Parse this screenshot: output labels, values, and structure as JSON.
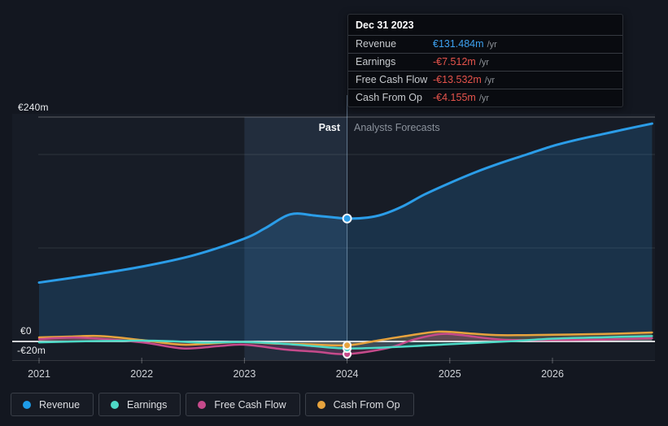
{
  "tooltip": {
    "title": "Dec 31 2023",
    "rows": [
      {
        "label": "Revenue",
        "value": "€131.484m",
        "unit": "/yr",
        "color": "#3da1f0"
      },
      {
        "label": "Earnings",
        "value": "-€7.512m",
        "unit": "/yr",
        "color": "#e5534b"
      },
      {
        "label": "Free Cash Flow",
        "value": "-€13.532m",
        "unit": "/yr",
        "color": "#e5534b"
      },
      {
        "label": "Cash From Op",
        "value": "-€4.155m",
        "unit": "/yr",
        "color": "#e5534b"
      }
    ]
  },
  "labels": {
    "past": "Past",
    "forecast": "Analysts Forecasts"
  },
  "y_axis": {
    "top": "€240m",
    "zero": "€0",
    "bottom": "-€20m"
  },
  "legend": {
    "items": [
      {
        "label": "Revenue",
        "color": "#1e9ce8"
      },
      {
        "label": "Earnings",
        "color": "#4ed9c6"
      },
      {
        "label": "Free Cash Flow",
        "color": "#c64a8b"
      },
      {
        "label": "Cash From Op",
        "color": "#e7a33d"
      }
    ]
  },
  "chart_data": {
    "type": "line",
    "title": "Past and forecast growth (€m per year)",
    "x_unit": "year",
    "x_ticks": [
      {
        "year": 2021,
        "label": "2021"
      },
      {
        "year": 2022,
        "label": "2022"
      },
      {
        "year": 2023,
        "label": "2023"
      },
      {
        "year": 2024,
        "label": "2024"
      },
      {
        "year": 2025,
        "label": "2025"
      },
      {
        "year": 2026,
        "label": "2026"
      }
    ],
    "x_range": [
      2021,
      2026.97
    ],
    "ylim_m": [
      -20,
      243
    ],
    "y_gridlines_m": [
      {
        "value": 240,
        "emphasis": true
      },
      {
        "value": 200
      },
      {
        "value": 100
      }
    ],
    "zero_line_m": 0,
    "divider_year": 2024,
    "highlight_band_years": [
      2023,
      2024
    ],
    "legend_position": "bottom",
    "series": [
      {
        "name": "Revenue",
        "color": "#2b9de8",
        "line_width": 3,
        "marker_year": 2024,
        "marker_value": 131.484,
        "points": [
          [
            2021,
            63
          ],
          [
            2021.5,
            71
          ],
          [
            2022,
            80
          ],
          [
            2022.5,
            92
          ],
          [
            2023,
            110
          ],
          [
            2023.2,
            121
          ],
          [
            2023.45,
            136
          ],
          [
            2023.7,
            134.5
          ],
          [
            2024,
            131.484
          ],
          [
            2024.2,
            132.5
          ],
          [
            2024.35,
            136
          ],
          [
            2024.55,
            145
          ],
          [
            2024.75,
            157
          ],
          [
            2025,
            169.5
          ],
          [
            2025.25,
            181
          ],
          [
            2025.5,
            191
          ],
          [
            2025.75,
            200
          ],
          [
            2026,
            209
          ],
          [
            2026.25,
            216
          ],
          [
            2026.5,
            222
          ],
          [
            2026.75,
            228
          ],
          [
            2026.97,
            233
          ]
        ]
      },
      {
        "name": "Cash From Op",
        "color": "#e7a33d",
        "line_width": 2.5,
        "marker_year": 2024,
        "marker_value": -4.155,
        "points": [
          [
            2021,
            4.3
          ],
          [
            2021.3,
            5.2
          ],
          [
            2021.6,
            5.8
          ],
          [
            2022,
            1.5
          ],
          [
            2022.4,
            -3.5
          ],
          [
            2022.8,
            -1.3
          ],
          [
            2023,
            -0.6
          ],
          [
            2023.3,
            -2.3
          ],
          [
            2023.6,
            -3
          ],
          [
            2024,
            -4.155
          ],
          [
            2024.3,
            1
          ],
          [
            2024.55,
            5.5
          ],
          [
            2024.9,
            10.5
          ],
          [
            2025.2,
            8.5
          ],
          [
            2025.5,
            6.7
          ],
          [
            2026,
            7.2
          ],
          [
            2026.5,
            8
          ],
          [
            2026.97,
            9.6
          ]
        ]
      },
      {
        "name": "Free Cash Flow",
        "color": "#c64a8b",
        "line_width": 2.5,
        "marker_year": 2024,
        "marker_value": -13.532,
        "points": [
          [
            2021,
            2.5
          ],
          [
            2021.4,
            4
          ],
          [
            2022,
            -1
          ],
          [
            2022.4,
            -7.5
          ],
          [
            2022.75,
            -5
          ],
          [
            2023,
            -3.5
          ],
          [
            2023.4,
            -8.7
          ],
          [
            2023.7,
            -11
          ],
          [
            2024,
            -13.532
          ],
          [
            2024.4,
            -7
          ],
          [
            2024.65,
            2
          ],
          [
            2024.9,
            7.8
          ],
          [
            2025.1,
            7
          ],
          [
            2025.5,
            2
          ],
          [
            2026,
            1.5
          ],
          [
            2026.5,
            2
          ],
          [
            2026.97,
            3.5
          ]
        ]
      },
      {
        "name": "Earnings",
        "color": "#4ed9c6",
        "line_width": 2.5,
        "marker_year": 2024,
        "marker_value": -7.512,
        "points": [
          [
            2021,
            -1
          ],
          [
            2021.5,
            0.3
          ],
          [
            2022,
            0.9
          ],
          [
            2022.3,
            0.2
          ],
          [
            2022.6,
            -1.3
          ],
          [
            2023,
            -0.6
          ],
          [
            2023.3,
            -2
          ],
          [
            2023.6,
            -4.3
          ],
          [
            2024,
            -7.512
          ],
          [
            2024.5,
            -5.8
          ],
          [
            2025,
            -2.9
          ],
          [
            2025.55,
            0
          ],
          [
            2026,
            2.9
          ],
          [
            2026.5,
            4.5
          ],
          [
            2026.97,
            5.8
          ]
        ]
      }
    ]
  }
}
